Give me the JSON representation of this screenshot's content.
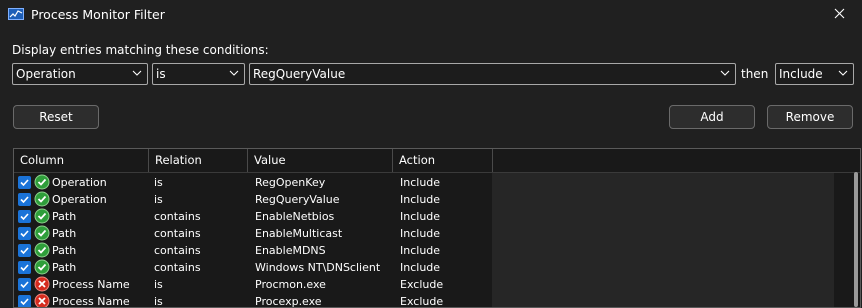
{
  "window": {
    "title": "Process Monitor Filter"
  },
  "filter": {
    "label": "Display entries matching these conditions:",
    "column": "Operation",
    "relation": "is",
    "value": "RegQueryValue",
    "then_label": "then",
    "action": "Include"
  },
  "buttons": {
    "reset": "Reset",
    "add": "Add",
    "remove": "Remove"
  },
  "table": {
    "columns": [
      "Column",
      "Relation",
      "Value",
      "Action"
    ],
    "rows": [
      {
        "column": "Operation",
        "relation": "is",
        "value": "RegOpenKey",
        "action": "Include",
        "checked": true,
        "status": "include"
      },
      {
        "column": "Operation",
        "relation": "is",
        "value": "RegQueryValue",
        "action": "Include",
        "checked": true,
        "status": "include"
      },
      {
        "column": "Path",
        "relation": "contains",
        "value": "EnableNetbios",
        "action": "Include",
        "checked": true,
        "status": "include"
      },
      {
        "column": "Path",
        "relation": "contains",
        "value": "EnableMulticast",
        "action": "Include",
        "checked": true,
        "status": "include"
      },
      {
        "column": "Path",
        "relation": "contains",
        "value": "EnableMDNS",
        "action": "Include",
        "checked": true,
        "status": "include"
      },
      {
        "column": "Path",
        "relation": "contains",
        "value": "Windows NT\\DNSclient",
        "action": "Include",
        "checked": true,
        "status": "include"
      },
      {
        "column": "Process Name",
        "relation": "is",
        "value": "Procmon.exe",
        "action": "Exclude",
        "checked": true,
        "status": "exclude"
      },
      {
        "column": "Process Name",
        "relation": "is",
        "value": "Procexp.exe",
        "action": "Exclude",
        "checked": true,
        "status": "exclude"
      }
    ]
  },
  "colors": {
    "include": "#2e9e3a",
    "exclude": "#d52b1e",
    "checkbox": "#1a73d8"
  }
}
